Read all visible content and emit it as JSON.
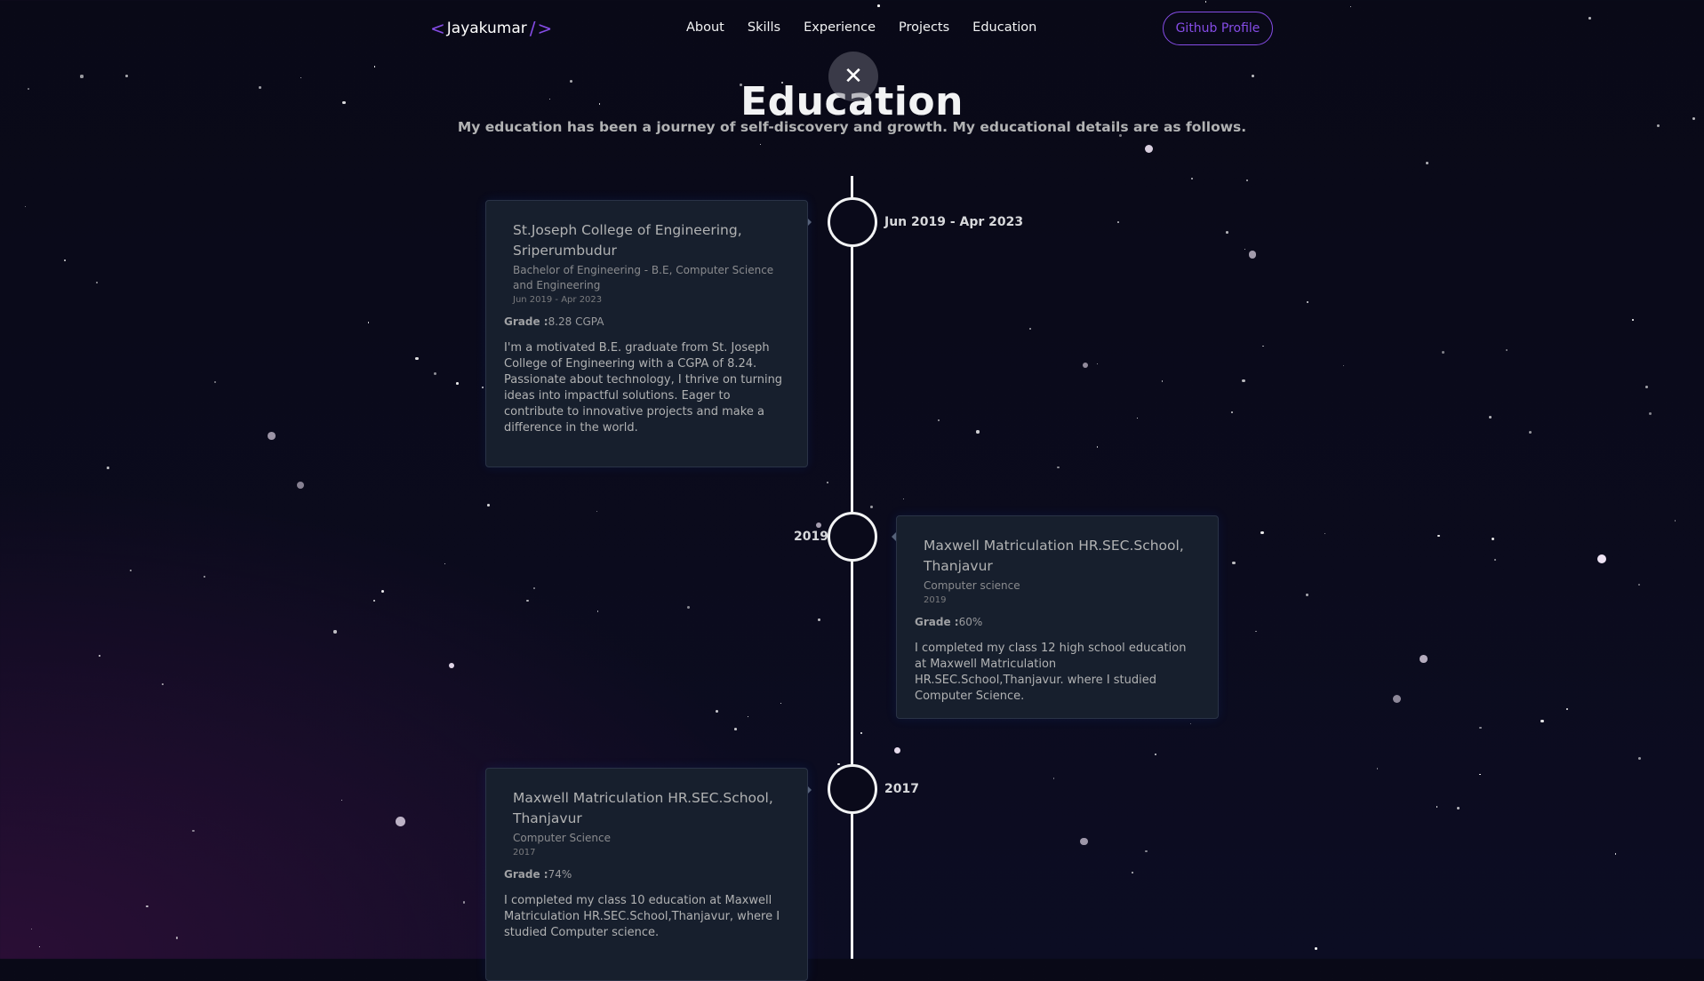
{
  "nav": {
    "logo": {
      "left_bracket": "<",
      "name": "Jayakumar",
      "slash": "/",
      "right_bracket": ">"
    },
    "links": [
      "About",
      "Skills",
      "Experience",
      "Projects",
      "Education"
    ],
    "github_button": "Github Profile"
  },
  "overlay_close": "✕",
  "section": {
    "title": "Education",
    "subtitle": "My education has been a journey of self-discovery and growth. My educational details are as follows."
  },
  "timeline": [
    {
      "side": "left",
      "date_label": "Jun 2019 - Apr 2023",
      "school": "St.Joseph College of Engineering, Sriperumbudur",
      "degree": "Bachelor of Engineering - B.E, Computer Science and Engineering",
      "date": "Jun 2019 - Apr 2023",
      "grade_label": "Grade :",
      "grade": "8.28 CGPA",
      "description": "I'm a motivated B.E. graduate from St. Joseph College of Engineering with a CGPA of 8.24. Passionate about technology, I thrive on turning ideas into impactful solutions. Eager to contribute to innovative projects and make a difference in the world."
    },
    {
      "side": "right",
      "date_label": "2019",
      "school": "Maxwell Matriculation HR.SEC.School, Thanjavur",
      "degree": "Computer science",
      "date": "2019",
      "grade_label": "Grade :",
      "grade": "60%",
      "description": "I completed my class 12 high school education at Maxwell Matriculation HR.SEC.School,Thanjavur. where I studied Computer Science."
    },
    {
      "side": "left",
      "date_label": "2017",
      "school": "Maxwell Matriculation HR.SEC.School, Thanjavur",
      "degree": "Computer Science",
      "date": "2017",
      "grade_label": "Grade :",
      "grade": "74%",
      "description": "I completed my class 10 education at Maxwell Matriculation HR.SEC.School,Thanjavur, where I studied Computer science."
    }
  ],
  "colors": {
    "accent": "#854ce6",
    "background": "#090917",
    "card": "#171f2d",
    "text_primary": "#f2f3f4",
    "text_secondary": "#b1b2b3"
  }
}
